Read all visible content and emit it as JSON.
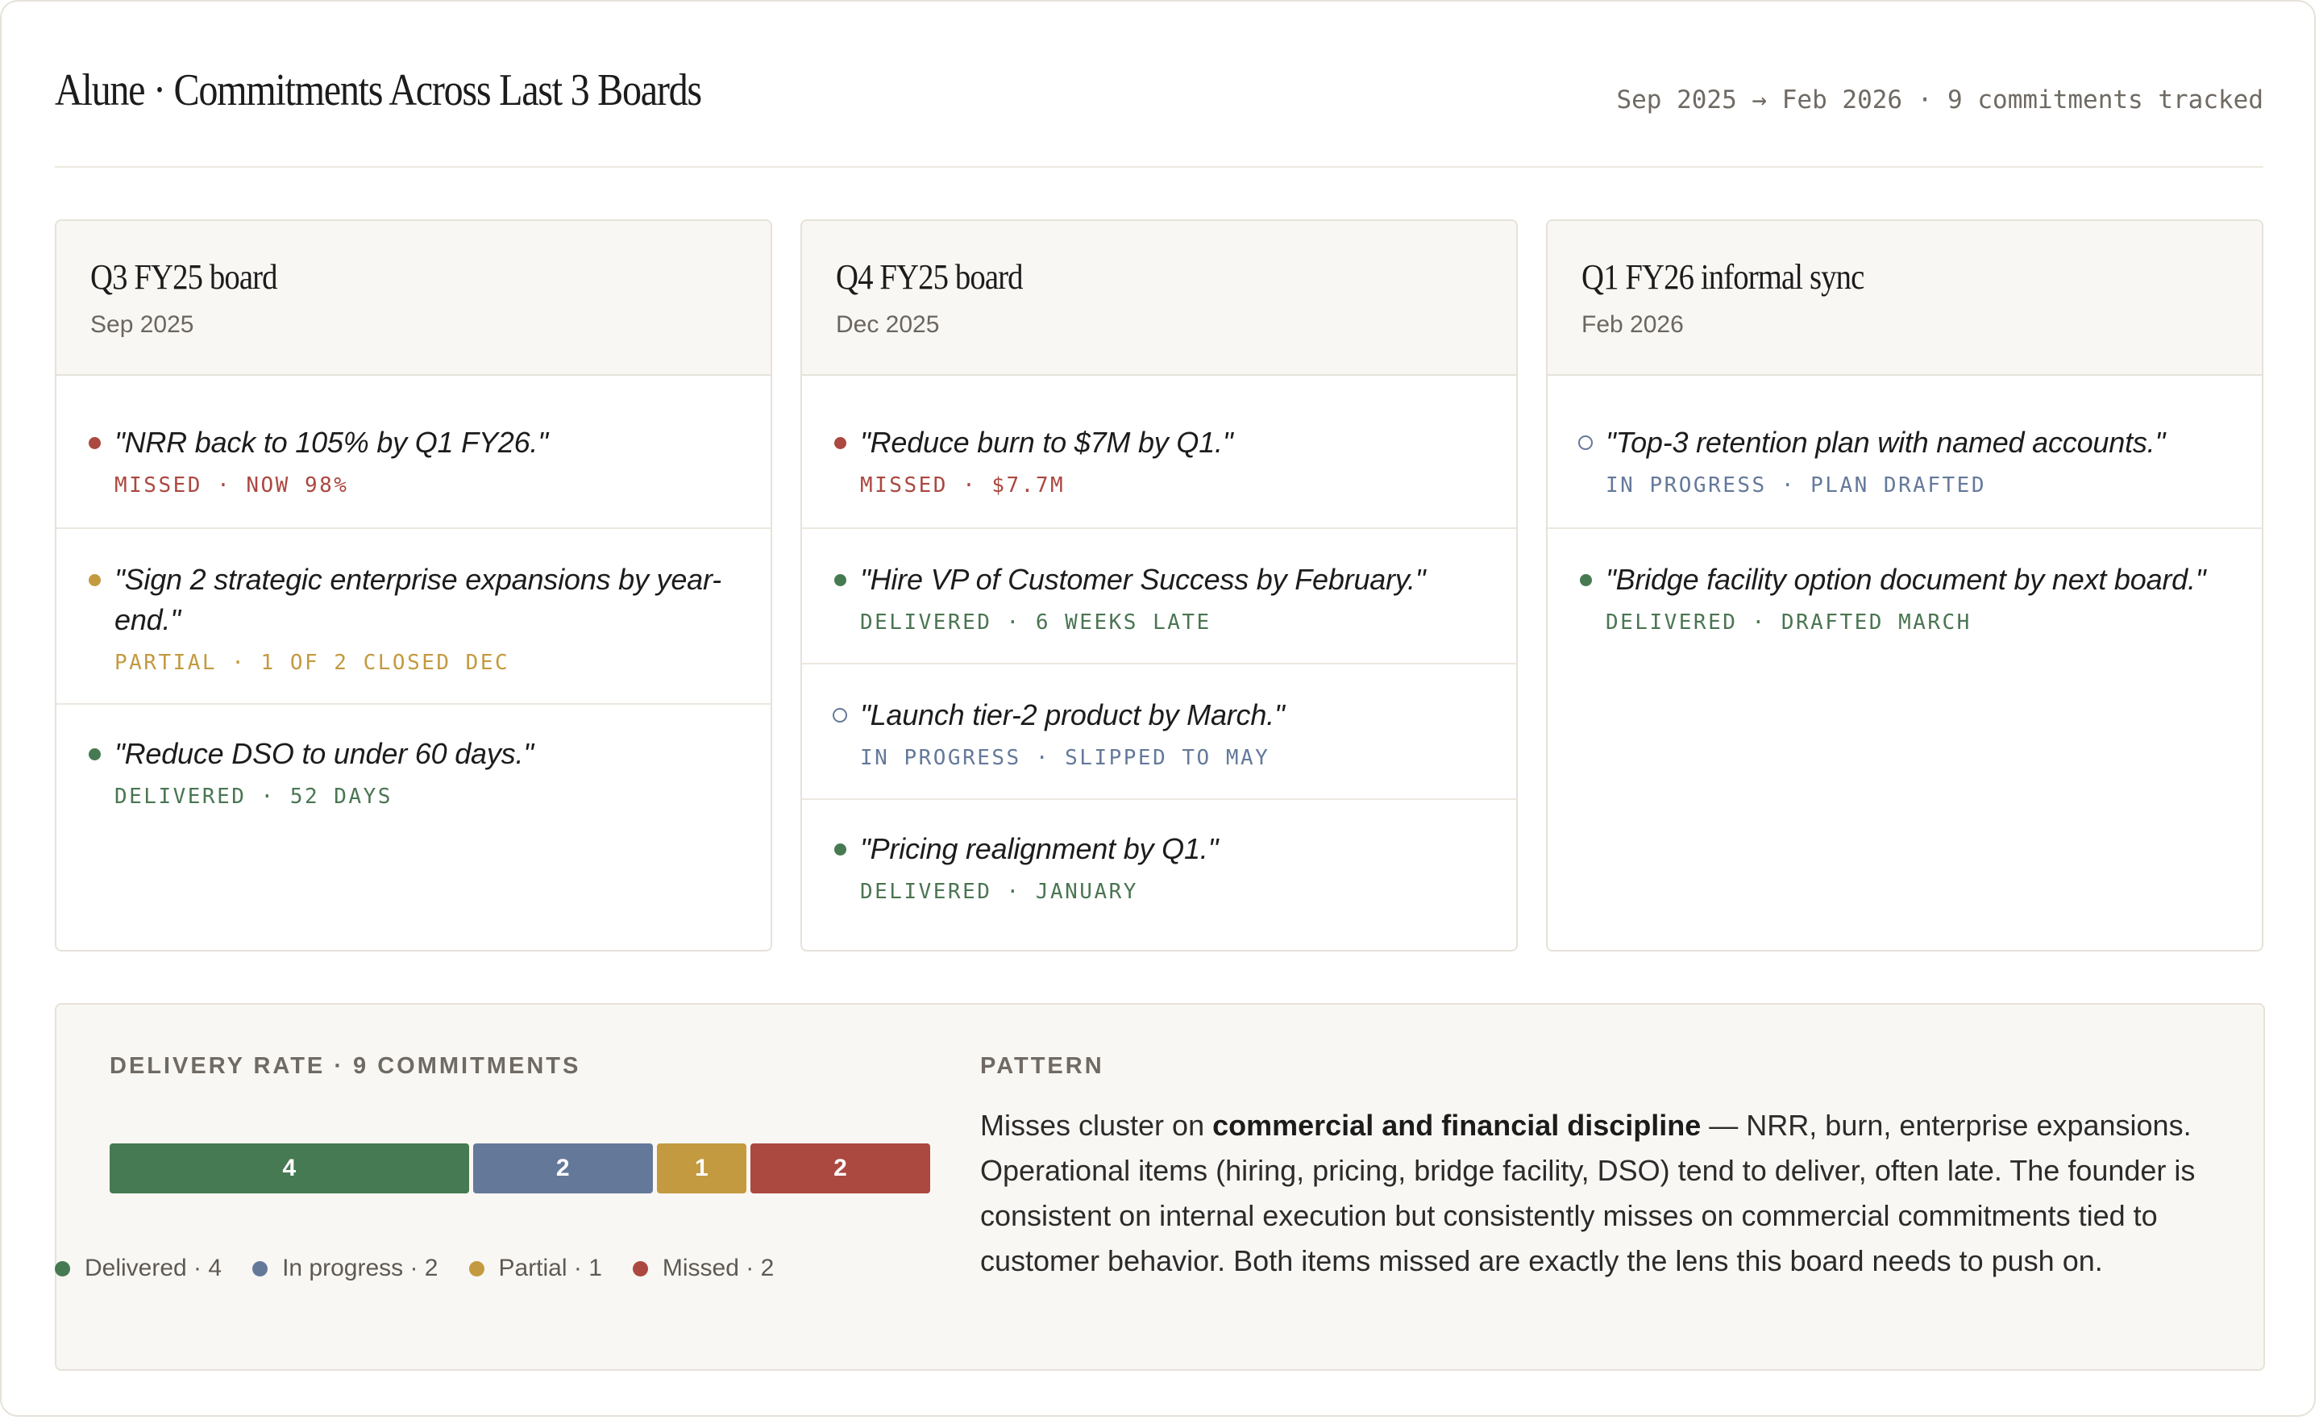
{
  "header": {
    "title": "Alune · Commitments Across Last 3 Boards",
    "meta": "Sep 2025 → Feb 2026 · 9 commitments tracked"
  },
  "boards": [
    {
      "name": "Q3 FY25 board",
      "date": "Sep 2025",
      "items": [
        {
          "quote": "\"NRR back to 105% by Q1 FY26.\"",
          "status": "MISSED · NOW 98%",
          "state": "missed"
        },
        {
          "quote": "\"Sign 2 strategic enterprise expansions by year-end.\"",
          "status": "PARTIAL · 1 OF 2 CLOSED DEC",
          "state": "partial"
        },
        {
          "quote": "\"Reduce DSO to under 60 days.\"",
          "status": "DELIVERED · 52 DAYS",
          "state": "delivered"
        }
      ]
    },
    {
      "name": "Q4 FY25 board",
      "date": "Dec 2025",
      "items": [
        {
          "quote": "\"Reduce burn to $7M by Q1.\"",
          "status": "MISSED · $7.7M",
          "state": "missed"
        },
        {
          "quote": "\"Hire VP of Customer Success by February.\"",
          "status": "DELIVERED · 6 WEEKS LATE",
          "state": "delivered"
        },
        {
          "quote": "\"Launch tier-2 product by March.\"",
          "status": "IN PROGRESS · SLIPPED TO MAY",
          "state": "progress"
        },
        {
          "quote": "\"Pricing realignment by Q1.\"",
          "status": "DELIVERED · JANUARY",
          "state": "delivered"
        }
      ]
    },
    {
      "name": "Q1 FY26 informal sync",
      "date": "Feb 2026",
      "items": [
        {
          "quote": "\"Top-3 retention plan with named accounts.\"",
          "status": "IN PROGRESS · PLAN DRAFTED",
          "state": "progress"
        },
        {
          "quote": "\"Bridge facility option document by next board.\"",
          "status": "DELIVERED · DRAFTED MARCH",
          "state": "delivered"
        }
      ]
    }
  ],
  "summary": {
    "delivery_label": "DELIVERY RATE · 9 COMMITMENTS",
    "bar": [
      {
        "label": "4",
        "value": 4,
        "state": "delivered"
      },
      {
        "label": "2",
        "value": 2,
        "state": "progress"
      },
      {
        "label": "1",
        "value": 1,
        "state": "partial"
      },
      {
        "label": "2",
        "value": 2,
        "state": "missed"
      }
    ],
    "legend": [
      {
        "label": "Delivered · 4",
        "state": "delivered"
      },
      {
        "label": "In progress · 2",
        "state": "progress"
      },
      {
        "label": "Partial · 1",
        "state": "partial"
      },
      {
        "label": "Missed · 2",
        "state": "missed"
      }
    ],
    "pattern_label": "PATTERN",
    "pattern_lead": "Misses cluster on ",
    "pattern_bold": "commercial and financial discipline",
    "pattern_rest": " — NRR, burn, enterprise expansions. Operational items (hiring, pricing, bridge facility, DSO) tend to deliver, often late. The founder is consistent on internal execution but consistently misses on commercial commitments tied to customer behavior. Both items missed are exactly the lens this board needs to push on."
  },
  "colors": {
    "delivered": "#467a52",
    "progress": "#64799a",
    "partial": "#c39a3f",
    "missed": "#ab4840"
  }
}
